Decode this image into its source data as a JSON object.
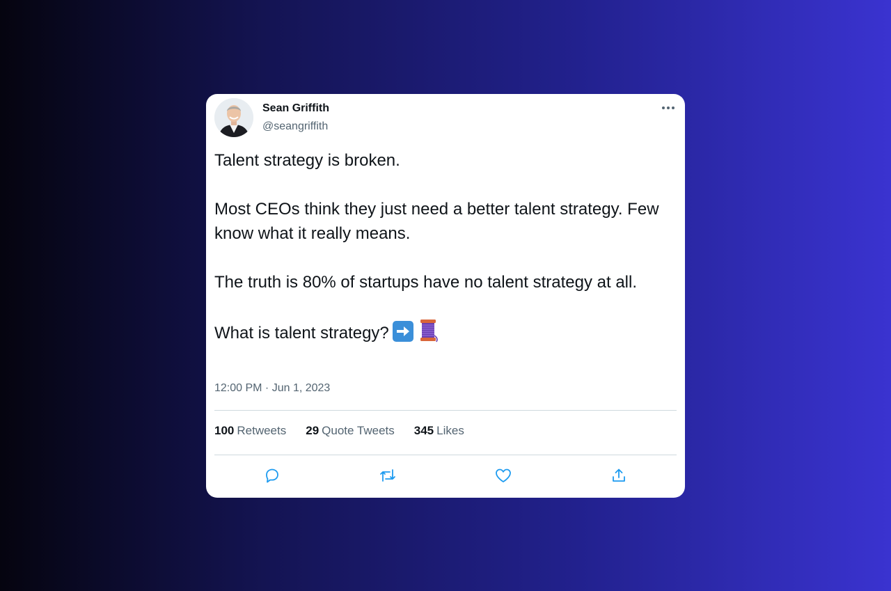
{
  "tweet": {
    "author_name": "Sean Griffith",
    "author_handle": "@seangriffith",
    "paragraphs": [
      "Talent strategy is broken.",
      "Most CEOs think they just need a better talent strategy. Few know what it really means.",
      "The truth is 80% of startups have no talent strategy at all.",
      "What is talent strategy?"
    ],
    "emoji_icons": [
      "right-arrow-icon",
      "thread-icon"
    ],
    "timestamp": "12:00 PM · Jun 1, 2023"
  },
  "stats": {
    "retweets_count": "100",
    "retweets_label": "Retweets",
    "quotes_count": "29",
    "quotes_label": "Quote Tweets",
    "likes_count": "345",
    "likes_label": "Likes"
  },
  "actions": [
    "reply-icon",
    "retweet-icon",
    "like-icon",
    "share-icon"
  ],
  "colors": {
    "card_bg": "#ffffff",
    "text_primary": "#0f1419",
    "text_secondary": "#536471",
    "icon_color": "#1d9bf0",
    "divider": "#cfd9de"
  }
}
